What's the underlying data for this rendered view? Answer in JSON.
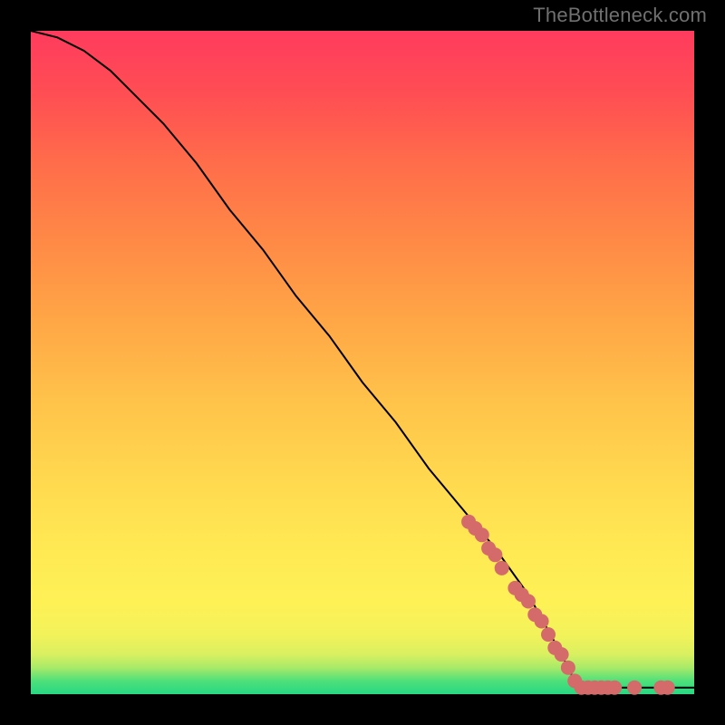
{
  "watermark": "TheBottleneck.com",
  "chart_data": {
    "type": "line",
    "title": "",
    "xlabel": "",
    "ylabel": "",
    "xlim": [
      0,
      100
    ],
    "ylim": [
      0,
      100
    ],
    "series": [
      {
        "name": "curve",
        "x": [
          0,
          4,
          8,
          12,
          16,
          20,
          25,
          30,
          35,
          40,
          45,
          50,
          55,
          60,
          65,
          70,
          75,
          80,
          82,
          85,
          88,
          90,
          92,
          94,
          96,
          98,
          100
        ],
        "y": [
          100,
          99,
          97,
          94,
          90,
          86,
          80,
          73,
          67,
          60,
          54,
          47,
          41,
          34,
          28,
          22,
          15,
          6,
          2,
          1,
          1,
          1,
          1,
          1,
          1,
          1,
          1
        ]
      }
    ],
    "markers": [
      {
        "x": 66,
        "y": 26
      },
      {
        "x": 67,
        "y": 25
      },
      {
        "x": 68,
        "y": 24
      },
      {
        "x": 69,
        "y": 22
      },
      {
        "x": 70,
        "y": 21
      },
      {
        "x": 71,
        "y": 19
      },
      {
        "x": 73,
        "y": 16
      },
      {
        "x": 74,
        "y": 15
      },
      {
        "x": 75,
        "y": 14
      },
      {
        "x": 76,
        "y": 12
      },
      {
        "x": 77,
        "y": 11
      },
      {
        "x": 78,
        "y": 9
      },
      {
        "x": 79,
        "y": 7
      },
      {
        "x": 80,
        "y": 6
      },
      {
        "x": 81,
        "y": 4
      },
      {
        "x": 82,
        "y": 2
      },
      {
        "x": 83,
        "y": 1
      },
      {
        "x": 84,
        "y": 1
      },
      {
        "x": 85,
        "y": 1
      },
      {
        "x": 86,
        "y": 1
      },
      {
        "x": 87,
        "y": 1
      },
      {
        "x": 88,
        "y": 1
      },
      {
        "x": 91,
        "y": 1
      },
      {
        "x": 95,
        "y": 1
      },
      {
        "x": 96,
        "y": 1
      }
    ],
    "marker_color": "#d46a6a",
    "marker_radius_px": 8
  }
}
